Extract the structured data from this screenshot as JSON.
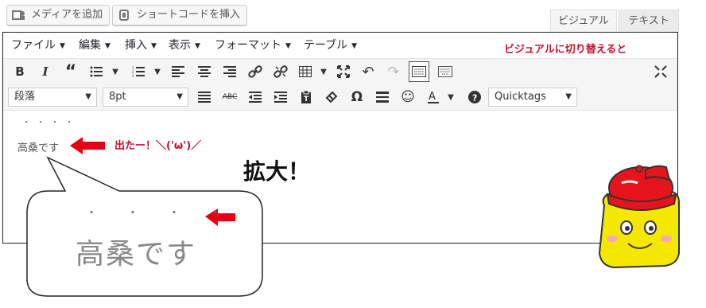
{
  "media_buttons": {
    "add_media_label": "メディアを追加",
    "shortcode_label": "ショートコードを挿入"
  },
  "tabs": {
    "visual": "ビジュアル",
    "text": "テキスト"
  },
  "menubar": {
    "items": [
      "ファイル",
      "編集",
      "挿入",
      "表示",
      "フォーマット",
      "テーブル"
    ]
  },
  "toolbar": {
    "paragraph_select": "段落",
    "font_size_select": "8pt",
    "quicktags_select": "Quicktags"
  },
  "annotations": {
    "switch_note": "ビジュアルに切り替えると",
    "came_out": "出たー！＼('ω')／",
    "zoom": "拡大！"
  },
  "content": {
    "dots": "・・・・",
    "text": "高桑です"
  },
  "bubble": {
    "dots": "・・・・",
    "text": "高桑です"
  },
  "colors": {
    "accent_red": "#c8102e",
    "arrow_red": "#e60012",
    "mascot_yellow": "#f5e800",
    "mascot_cap": "#e8141c"
  }
}
